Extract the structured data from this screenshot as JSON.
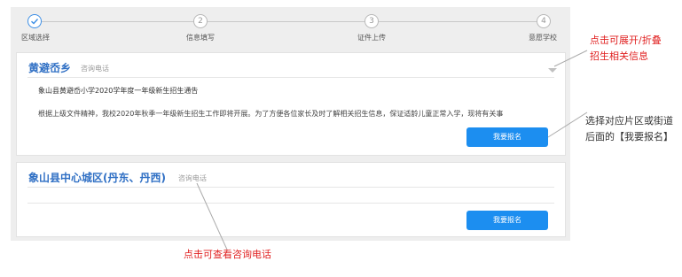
{
  "stepper": {
    "steps": [
      {
        "label": "区域选择",
        "number": "",
        "active": true
      },
      {
        "label": "信息填写",
        "number": "2",
        "active": false
      },
      {
        "label": "证件上传",
        "number": "3",
        "active": false
      },
      {
        "label": "意愿学校",
        "number": "4",
        "active": false
      }
    ]
  },
  "cards": [
    {
      "title": "黄避岙乡",
      "phone_label": "咨询电话",
      "notice_title": "象山县黄避岙小学2020学年度一年级新生招生通告",
      "notice_body": "根据上级文件精神，我校2020年秋季一年级新生招生工作即将开展。为了方便各位家长及时了解相关招生信息，保证适龄儿童正常入学，现将有关事",
      "apply_label": "我要报名"
    },
    {
      "title": "象山县中心城区(丹东、丹西)",
      "phone_label": "咨询电话",
      "apply_label": "我要报名"
    }
  ],
  "annotations": {
    "expand_line1": "点击可展开/折叠",
    "expand_line2": "招生相关信息",
    "select_line1": "选择对应片区或街道",
    "select_line2": "后面的【我要报名】",
    "phone_hint": "点击可查看咨询电话"
  },
  "colors": {
    "accent": "#1c8ef0",
    "title_blue": "#2f6fc4",
    "annotation_red": "#e02020",
    "panel_bg": "#eeeeee"
  },
  "icons": {
    "step1": "check-icon",
    "toggle": "chevron-down-icon"
  }
}
